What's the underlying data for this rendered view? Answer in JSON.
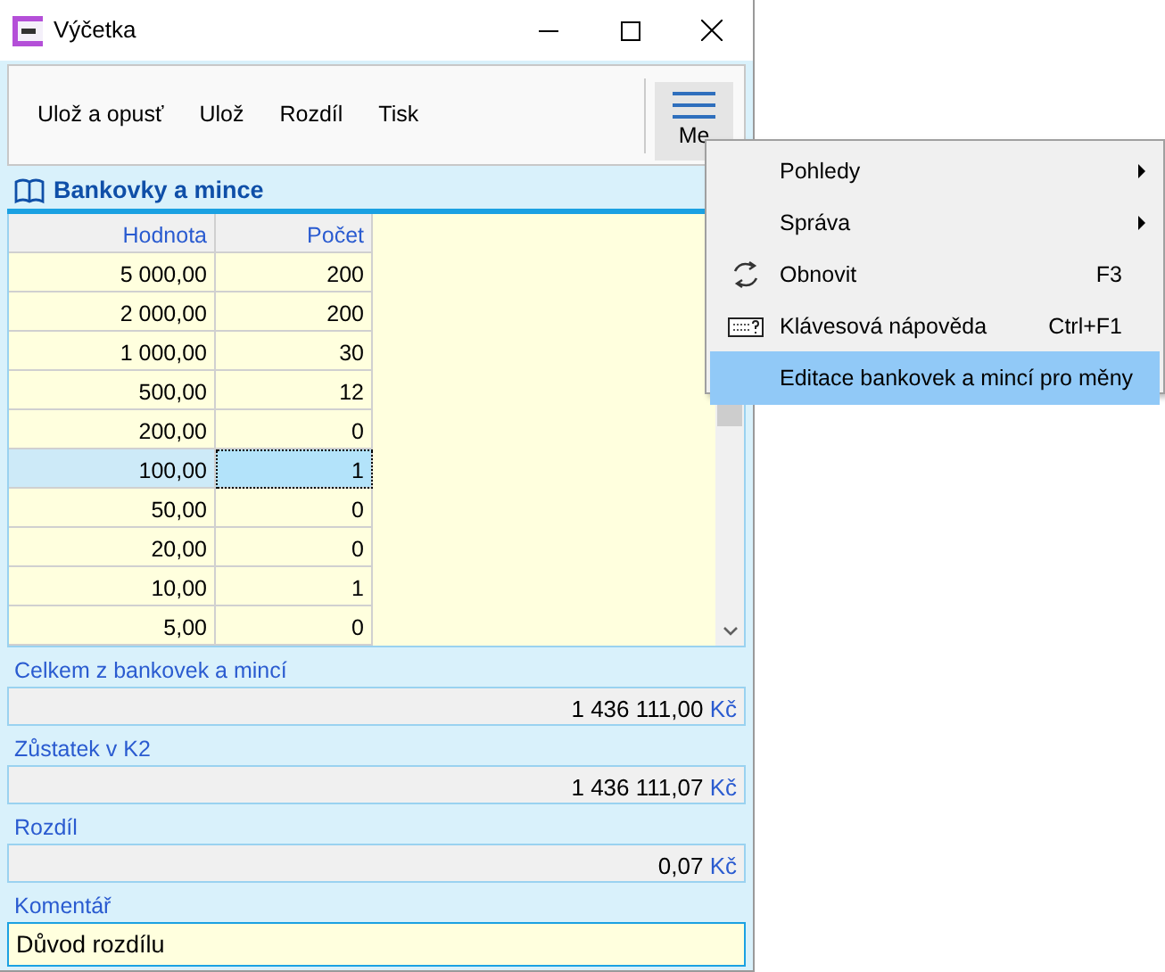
{
  "window": {
    "title": "Výčetka"
  },
  "toolbar": {
    "buttons": [
      "Ulož a opusť",
      "Ulož",
      "Rozdíl",
      "Tisk"
    ],
    "menu_button": "Me"
  },
  "section": {
    "title": "Bankovky a mince"
  },
  "table": {
    "columns": [
      "Hodnota",
      "Počet"
    ],
    "rows": [
      {
        "value": "5 000,00",
        "count": "200",
        "selected": false
      },
      {
        "value": "2 000,00",
        "count": "200",
        "selected": false
      },
      {
        "value": "1 000,00",
        "count": "30",
        "selected": false
      },
      {
        "value": "500,00",
        "count": "12",
        "selected": false
      },
      {
        "value": "200,00",
        "count": "0",
        "selected": false
      },
      {
        "value": "100,00",
        "count": "1",
        "selected": true
      },
      {
        "value": "50,00",
        "count": "0",
        "selected": false
      },
      {
        "value": "20,00",
        "count": "0",
        "selected": false
      },
      {
        "value": "10,00",
        "count": "1",
        "selected": false
      },
      {
        "value": "5,00",
        "count": "0",
        "selected": false
      }
    ]
  },
  "fields": [
    {
      "label": "Celkem z bankovek a mincí",
      "kind": "readonly",
      "value": "1 436 111,00",
      "currency": "Kč"
    },
    {
      "label": "Zůstatek v K2",
      "kind": "readonly",
      "value": "1 436 111,07",
      "currency": "Kč"
    },
    {
      "label": "Rozdíl",
      "kind": "readonly",
      "value": "0,07",
      "currency": "Kč"
    },
    {
      "label": "Komentář",
      "kind": "input",
      "value": "Důvod rozdílu"
    }
  ],
  "context_menu": {
    "items": [
      {
        "label": "Pohledy",
        "submenu": true,
        "selected": false
      },
      {
        "label": "Správa",
        "submenu": true,
        "selected": false
      },
      {
        "label": "Obnovit",
        "kind": "refresh",
        "shortcut": "F3",
        "submenu": false,
        "selected": false
      },
      {
        "label": "Klávesová nápověda",
        "kind": "keyboard",
        "shortcut": "Ctrl+F1",
        "submenu": false,
        "selected": false
      },
      {
        "label": "Editace bankovek a mincí pro měny",
        "submenu": false,
        "selected": true
      }
    ]
  }
}
